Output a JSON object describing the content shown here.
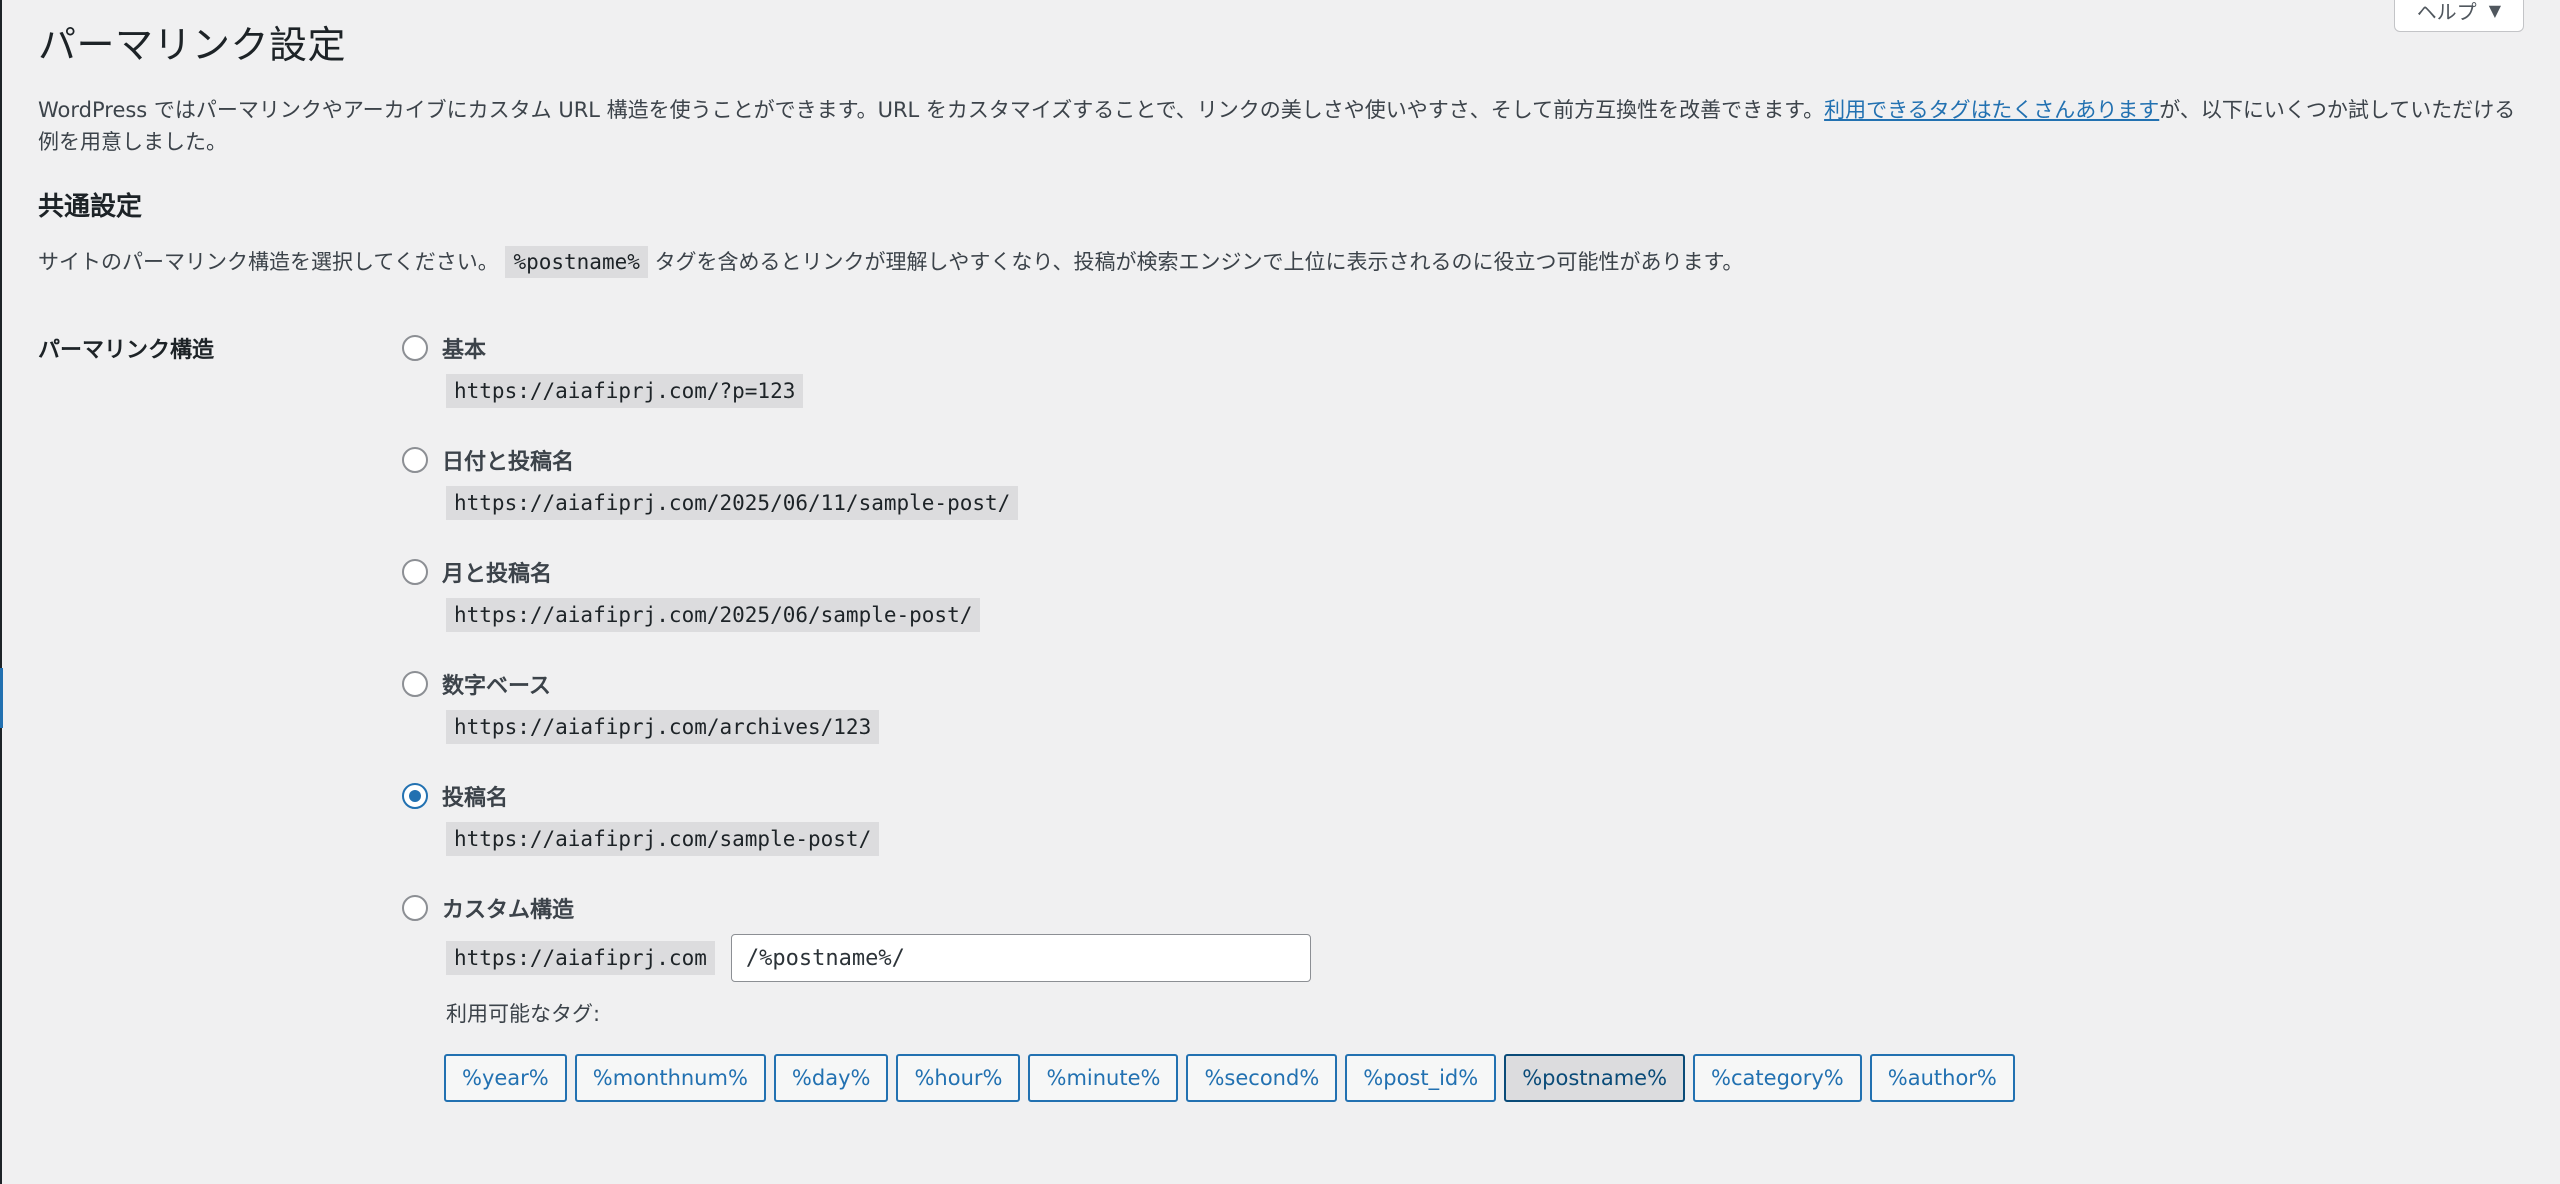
{
  "header": {
    "title": "パーマリンク設定",
    "help_label": "ヘルプ",
    "help_arrow": "▼"
  },
  "intro": {
    "text_before": "WordPress ではパーマリンクやアーカイブにカスタム URL 構造を使うことができます。URL をカスタマイズすることで、リンクの美しさや使いやすさ、そして前方互換性を改善できます。",
    "link": "利用できるタグはたくさんあります",
    "text_after": "が、以下にいくつか試していただける例を用意しました。"
  },
  "common_settings": {
    "heading": "共通設定",
    "desc_before": "サイトのパーマリンク構造を選択してください。",
    "desc_code": "%postname%",
    "desc_after": "タグを含めるとリンクが理解しやすくなり、投稿が検索エンジンで上位に表示されるのに役立つ可能性があります。"
  },
  "permalink": {
    "field_label": "パーマリンク構造",
    "options": [
      {
        "label": "基本",
        "example": "https://aiafiprj.com/?p=123",
        "checked": false
      },
      {
        "label": "日付と投稿名",
        "example": "https://aiafiprj.com/2025/06/11/sample-post/",
        "checked": false
      },
      {
        "label": "月と投稿名",
        "example": "https://aiafiprj.com/2025/06/sample-post/",
        "checked": false
      },
      {
        "label": "数字ベース",
        "example": "https://aiafiprj.com/archives/123",
        "checked": false
      },
      {
        "label": "投稿名",
        "example": "https://aiafiprj.com/sample-post/",
        "checked": true
      },
      {
        "label": "カスタム構造",
        "checked": false
      }
    ],
    "custom": {
      "base": "https://aiafiprj.com",
      "value": "/%postname%/"
    },
    "tags_label": "利用可能なタグ:",
    "tags": [
      "%year%",
      "%monthnum%",
      "%day%",
      "%hour%",
      "%minute%",
      "%second%",
      "%post_id%",
      "%postname%",
      "%category%",
      "%author%"
    ],
    "active_tag": "%postname%"
  },
  "colors": {
    "accent": "#2271b1",
    "background": "#f0f0f1",
    "code_bg": "#dcdcde"
  }
}
